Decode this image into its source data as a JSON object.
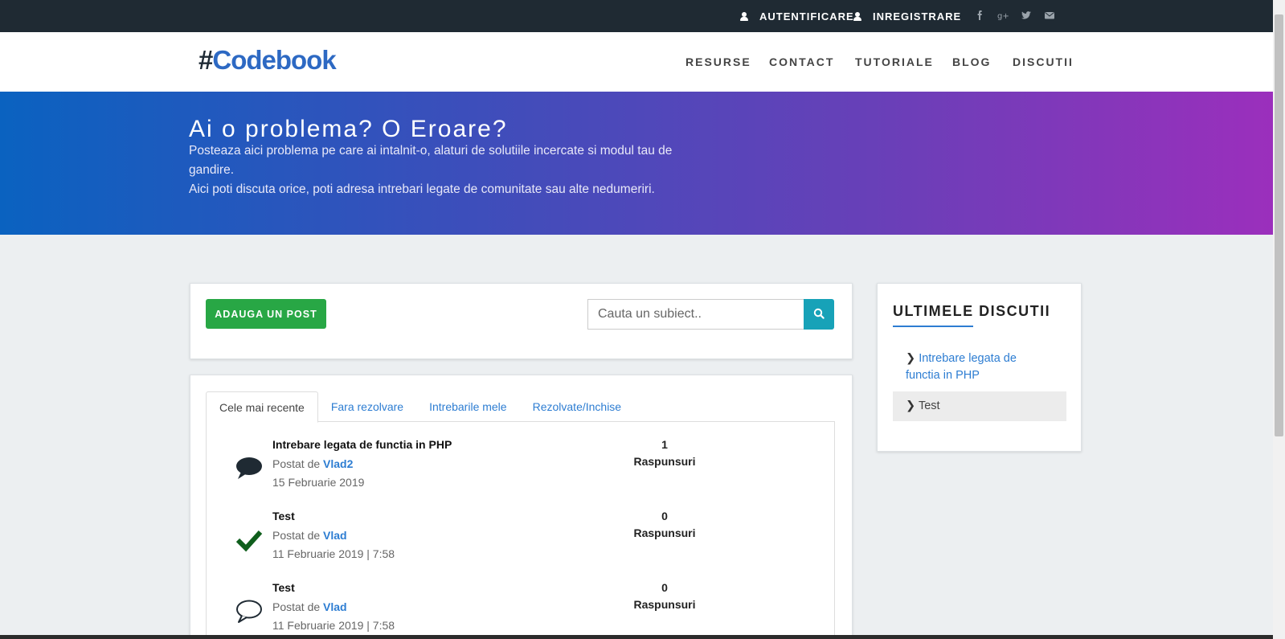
{
  "topbar": {
    "login": "AUTENTIFICARE",
    "register": "INREGISTRARE",
    "social_icons": [
      "facebook-icon",
      "google-plus-icon",
      "twitter-icon",
      "envelope-icon"
    ]
  },
  "logo": {
    "hash": "#",
    "name": "Codebook"
  },
  "nav": [
    "RESURSE",
    "CONTACT",
    "TUTORIALE",
    "BLOG",
    "DISCUTII"
  ],
  "hero": {
    "title": "Ai o problema? O Eroare?",
    "line1": "Posteaza aici problema pe care ai intalnit-o, alaturi de solutiile incercate si modul tau de gandire.",
    "line2": "Aici poti discuta orice, poti adresa intrebari legate de comunitate sau alte nedumeriri."
  },
  "actions": {
    "add_post": "ADAUGA UN POST",
    "search_placeholder": "Cauta un subiect.."
  },
  "tabs": [
    "Cele mai recente",
    "Fara rezolvare",
    "Intrebarile mele",
    "Rezolvate/Inchise"
  ],
  "threads": [
    {
      "title": "Intrebare legata de functia in PHP",
      "posted_by": "Postat de",
      "author": "Vlad2",
      "date": "15 Februarie 2019",
      "replies": "1",
      "replies_label": "Raspunsuri",
      "icon": "comment-solid-icon"
    },
    {
      "title": "Test",
      "posted_by": "Postat de",
      "author": "Vlad",
      "date": "11 Februarie 2019 | 7:58",
      "replies": "0",
      "replies_label": "Raspunsuri",
      "icon": "check-icon"
    },
    {
      "title": "Test",
      "posted_by": "Postat de",
      "author": "Vlad",
      "date": "11 Februarie 2019 | 7:58",
      "replies": "0",
      "replies_label": "Raspunsuri",
      "icon": "comment-outline-icon"
    }
  ],
  "sidebar": {
    "title": "ULTIMELE DISCUTII",
    "items": [
      "Intrebare legata de functia in PHP",
      "Test"
    ]
  },
  "colors": {
    "topbar": "#1f2a33",
    "brand_blue": "#2d69c3",
    "link": "#2d7dd2",
    "add_button": "#28a745",
    "search_button": "#17a2b8",
    "check_green": "#0f5e1c"
  }
}
